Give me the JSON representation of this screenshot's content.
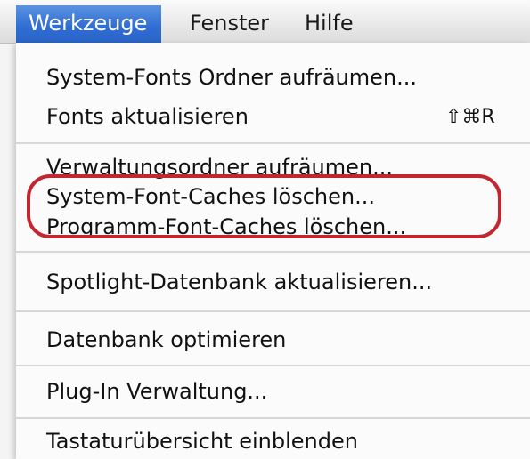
{
  "menubar": {
    "items": [
      {
        "label": "Werkzeuge",
        "active": true
      },
      {
        "label": "Fenster",
        "active": false
      },
      {
        "label": "Hilfe",
        "active": false
      }
    ]
  },
  "menu": {
    "items": [
      {
        "label": "System-Fonts Ordner aufräumen..."
      },
      {
        "label": "Fonts aktualisieren",
        "shortcut": "⇧⌘R"
      },
      {
        "label": "Verwaltungsordner aufräumen..."
      },
      {
        "label": "System-Font-Caches löschen..."
      },
      {
        "label": "Programm-Font-Caches löschen..."
      },
      {
        "label": "Spotlight-Datenbank aktualisieren..."
      },
      {
        "label": "Datenbank optimieren"
      },
      {
        "label": "Plug-In Verwaltung..."
      },
      {
        "label": "Tastaturübersicht einblenden"
      }
    ]
  },
  "colors": {
    "active_menu": "#2f6cd3",
    "highlight_ring": "#c3262f"
  }
}
